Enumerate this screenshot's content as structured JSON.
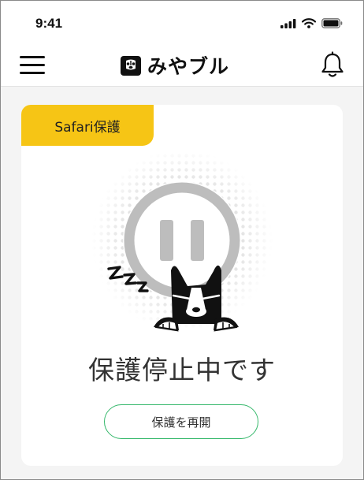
{
  "status_bar": {
    "time": "9:41"
  },
  "header": {
    "logo_text": "みやブル"
  },
  "card": {
    "tag_label": "Safari保護",
    "status_text": "保護停止中です",
    "resume_button_label": "保護を再開"
  },
  "colors": {
    "tag_yellow": "#f6c515",
    "button_border_green": "#35b86b",
    "pause_gray": "#bdbdbd"
  },
  "icons": [
    "menu-icon",
    "bell-icon",
    "dog-logo-icon",
    "signal-icon",
    "wifi-icon",
    "battery-icon",
    "pause-icon",
    "sleeping-dog-icon"
  ]
}
